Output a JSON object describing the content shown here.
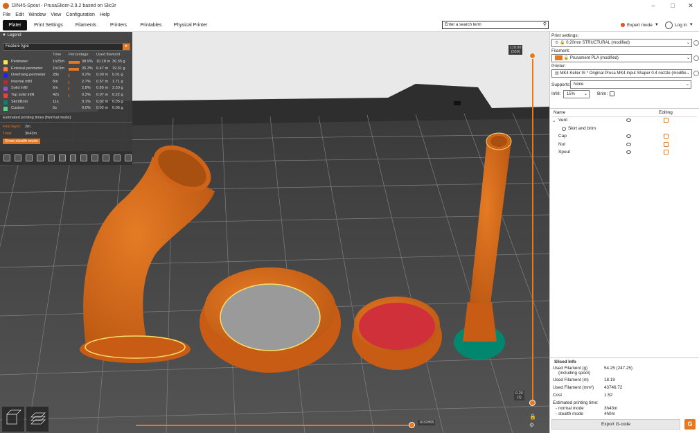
{
  "window": {
    "title": "DIN45-Spout - PrusaSlicer-2.9.2 based on Slic3r",
    "controls": [
      "minimize",
      "maximize",
      "close"
    ]
  },
  "menu": [
    "File",
    "Edit",
    "Window",
    "View",
    "Configuration",
    "Help"
  ],
  "tabs": [
    {
      "label": "Plater",
      "active": true
    },
    {
      "label": "Print Settings",
      "active": false
    },
    {
      "label": "Filaments",
      "active": false
    },
    {
      "label": "Printers",
      "active": false
    },
    {
      "label": "Printables",
      "active": false
    },
    {
      "label": "Physical Printer",
      "active": false
    }
  ],
  "search": {
    "placeholder": "Enter a search term"
  },
  "mode": {
    "label": "Expert mode",
    "color": "#e8501e"
  },
  "login": {
    "label": "Log in"
  },
  "legend": {
    "title": "Legend",
    "view_type": "Feature type",
    "columns": {
      "time": "Time",
      "percentage": "Percentage",
      "used": "Used filament"
    },
    "rows": [
      {
        "name": "Perimeter",
        "color": "#ffe64d",
        "time": "1h25m",
        "pct": "38.9%",
        "meters": "10.18 m",
        "grams": "30.35 g",
        "fraction": 0.389
      },
      {
        "name": "External perimeter",
        "color": "#ff7d38",
        "time": "1h19m",
        "pct": "35.3%",
        "meters": "6.47 m",
        "grams": "19.31 g",
        "fraction": 0.353
      },
      {
        "name": "Overhang perimeter",
        "color": "#1f1fff",
        "time": "28s",
        "pct": "0.2%",
        "meters": "0.00 m",
        "grams": "0.01 g",
        "fraction": 0.002
      },
      {
        "name": "Internal infill",
        "color": "#b03029",
        "time": "6m",
        "pct": "2.7%",
        "meters": "0.57 m",
        "grams": "1.71 g",
        "fraction": 0.027
      },
      {
        "name": "Solid infill",
        "color": "#9654cc",
        "time": "6m",
        "pct": "2.8%",
        "meters": "0.85 m",
        "grams": "2.53 g",
        "fraction": 0.028
      },
      {
        "name": "Top solid infill",
        "color": "#f04040",
        "time": "42s",
        "pct": "0.3%",
        "meters": "0.07 m",
        "grams": "0.22 g",
        "fraction": 0.003
      },
      {
        "name": "Skirt/Brim",
        "color": "#00876e",
        "time": "11s",
        "pct": "0.1%",
        "meters": "0.02 m",
        "grams": "0.05 g",
        "fraction": 0.001
      },
      {
        "name": "Custom",
        "color": "#5ed28c",
        "time": "5s",
        "pct": "0.0%",
        "meters": "0.02 m",
        "grams": "0.06 g",
        "fraction": 0.0
      }
    ],
    "estimated_title": "Estimated printing times [Normal mode]:",
    "first_layer_label": "First layer:",
    "first_layer_value": "2m",
    "total_label": "Total:",
    "total_value": "3h43m",
    "stealth_button": "Show stealth mode"
  },
  "gcode_toolbar": [
    "travel-icon",
    "wipe-icon",
    "retractions-icon",
    "deretractions-icon",
    "seams-icon",
    "tool-changes-icon",
    "color-changes-icon",
    "pause-prints-icon",
    "custom-gcodes-icon",
    "center-of-gravity-icon",
    "shells-icon",
    "tool-marker-icon"
  ],
  "vertical_slider": {
    "top_value": "110.00",
    "top_layer": "(550)",
    "bottom_value": "0.20",
    "bottom_layer": "(1)"
  },
  "horizontal_slider": {
    "value": "1032865"
  },
  "right_panel": {
    "print_settings_label": "Print settings:",
    "print_settings_value": "0.20mm STRUCTURAL (modified)",
    "filament_label": "Filament:",
    "filament_value": "Prusament PLA (modified)",
    "filament_color": "#e87820",
    "printer_label": "Printer:",
    "printer_value": "MK4 Keller IS * Original Prusa MK4 Input Shaper 0.4 nozzle (modified)",
    "supports_label": "Supports:",
    "supports_value": "None",
    "infill_label": "Infill:",
    "infill_value": "15%",
    "brim_label": "Brim:",
    "object_list": {
      "name_header": "Name",
      "editing_header": "Editing",
      "items": [
        {
          "name": "Vent",
          "level": 0,
          "expanded": true
        },
        {
          "name": "Skirt and brim",
          "level": 1
        },
        {
          "name": "Cap",
          "level": 0
        },
        {
          "name": "Nut",
          "level": 0
        },
        {
          "name": "Spout",
          "level": 0
        }
      ]
    },
    "sliced_info": {
      "title": "Sliced Info",
      "rows": [
        {
          "label": "Used Filament (g)",
          "sub": "(including spool)",
          "value": "54.25 (247.25)"
        },
        {
          "label": "Used Filament (m)",
          "value": "18.19"
        },
        {
          "label": "Used Filament (mm³)",
          "value": "43746.72"
        },
        {
          "label": "Cost",
          "value": "1.52"
        },
        {
          "label": "Estimated printing time:",
          "value": ""
        },
        {
          "label": "- normal mode",
          "value": "3h43m"
        },
        {
          "label": "- stealth mode",
          "value": "4h0m"
        }
      ],
      "export_label": "Export G-code",
      "g_icon": "G"
    }
  },
  "colors": {
    "accent": "#e87820",
    "model": "#d8691a",
    "brim": "#00876e",
    "top_infill": "#d0303a"
  }
}
